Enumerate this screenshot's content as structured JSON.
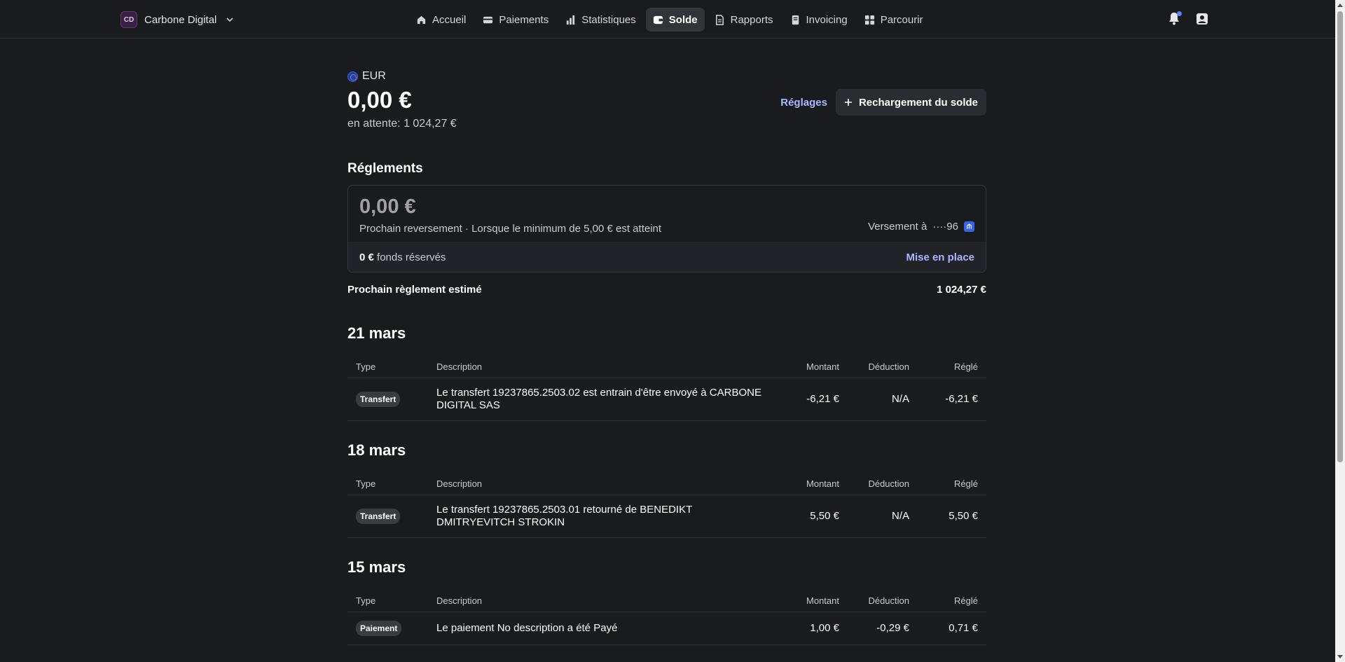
{
  "header": {
    "account_initials": "CD",
    "account_name": "Carbone Digital",
    "nav": [
      {
        "label": "Accueil",
        "icon": "home-icon"
      },
      {
        "label": "Paiements",
        "icon": "payments-icon"
      },
      {
        "label": "Statistiques",
        "icon": "bar-chart-icon"
      },
      {
        "label": "Solde",
        "icon": "wallet-icon",
        "active": true
      },
      {
        "label": "Rapports",
        "icon": "document-icon"
      },
      {
        "label": "Invoicing",
        "icon": "invoice-icon"
      },
      {
        "label": "Parcourir",
        "icon": "grid-icon"
      }
    ]
  },
  "balance": {
    "currency": "EUR",
    "amount": "0,00 €",
    "pending": "en attente: 1 024,27 €",
    "settings_label": "Réglages",
    "topup_label": "Rechargement du solde"
  },
  "reglements": {
    "title": "Réglements",
    "amount": "0,00 €",
    "next_payout": "Prochain reversement · Lorsque le minimum de 5,00 € est atteint",
    "payout_to": "Versement à",
    "account_mask": "····96",
    "reserved_amount": "0 €",
    "reserved_label": "fonds réservés",
    "setup_label": "Mise en place",
    "estimate_label": "Prochain règlement estimé",
    "estimate_value": "1 024,27 €"
  },
  "columns": {
    "type": "Type",
    "description": "Description",
    "amount": "Montant",
    "deduction": "Déduction",
    "settled": "Réglé"
  },
  "days": [
    {
      "date": "21 mars",
      "rows": [
        {
          "type": "Transfert",
          "description": "Le transfert 19237865.2503.02 est entrain d'être envoyé à CARBONE DIGITAL SAS",
          "amount": "-6,21 €",
          "deduction": "N/A",
          "settled": "-6,21 €"
        }
      ]
    },
    {
      "date": "18 mars",
      "rows": [
        {
          "type": "Transfert",
          "description": "Le transfert 19237865.2503.01 retourné de BENEDIKT DMITRYEVITCH STROKIN",
          "amount": "5,50 €",
          "deduction": "N/A",
          "settled": "5,50 €"
        }
      ]
    },
    {
      "date": "15 mars",
      "rows": [
        {
          "type": "Paiement",
          "description": "Le paiement No description a été Payé",
          "amount": "1,00 €",
          "deduction": "-0,29 €",
          "settled": "0,71 €"
        }
      ]
    }
  ],
  "colors": {
    "background": "#1a1b1f",
    "accent_link": "#a9b8ff",
    "active_nav": "#33343a",
    "notification_dot": "#5a86f0",
    "bank_icon": "#3563f0"
  }
}
